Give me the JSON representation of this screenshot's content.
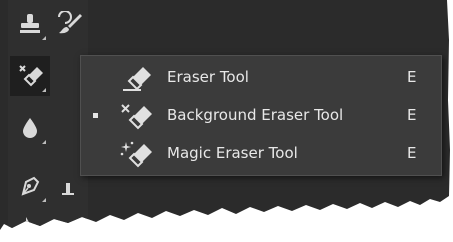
{
  "toolbar": {
    "tools": [
      {
        "name": "clone-stamp-tool",
        "icon": "stamp-icon"
      },
      {
        "name": "history-brush-tool",
        "icon": "history-brush-icon"
      },
      {
        "name": "eraser-tool-group",
        "icon": "background-eraser-icon",
        "active": true
      },
      {
        "name": "blur-tool",
        "icon": "drop-icon"
      },
      {
        "name": "pen-tool",
        "icon": "pen-nib-icon"
      },
      {
        "name": "type-tool",
        "icon": "type-icon"
      }
    ]
  },
  "flyout_menu": {
    "items": [
      {
        "label": "Eraser Tool",
        "shortcut": "E",
        "icon": "eraser-icon",
        "selected": false
      },
      {
        "label": "Background Eraser Tool",
        "shortcut": "E",
        "icon": "background-eraser-icon",
        "selected": true
      },
      {
        "label": "Magic Eraser Tool",
        "shortcut": "E",
        "icon": "magic-eraser-icon",
        "selected": false
      }
    ]
  },
  "colors": {
    "panel_bg": "#2b2b2b",
    "flyout_bg": "#3b3b3b",
    "text": "#e8e8e8",
    "active_tool_bg": "#1f1f1f"
  }
}
